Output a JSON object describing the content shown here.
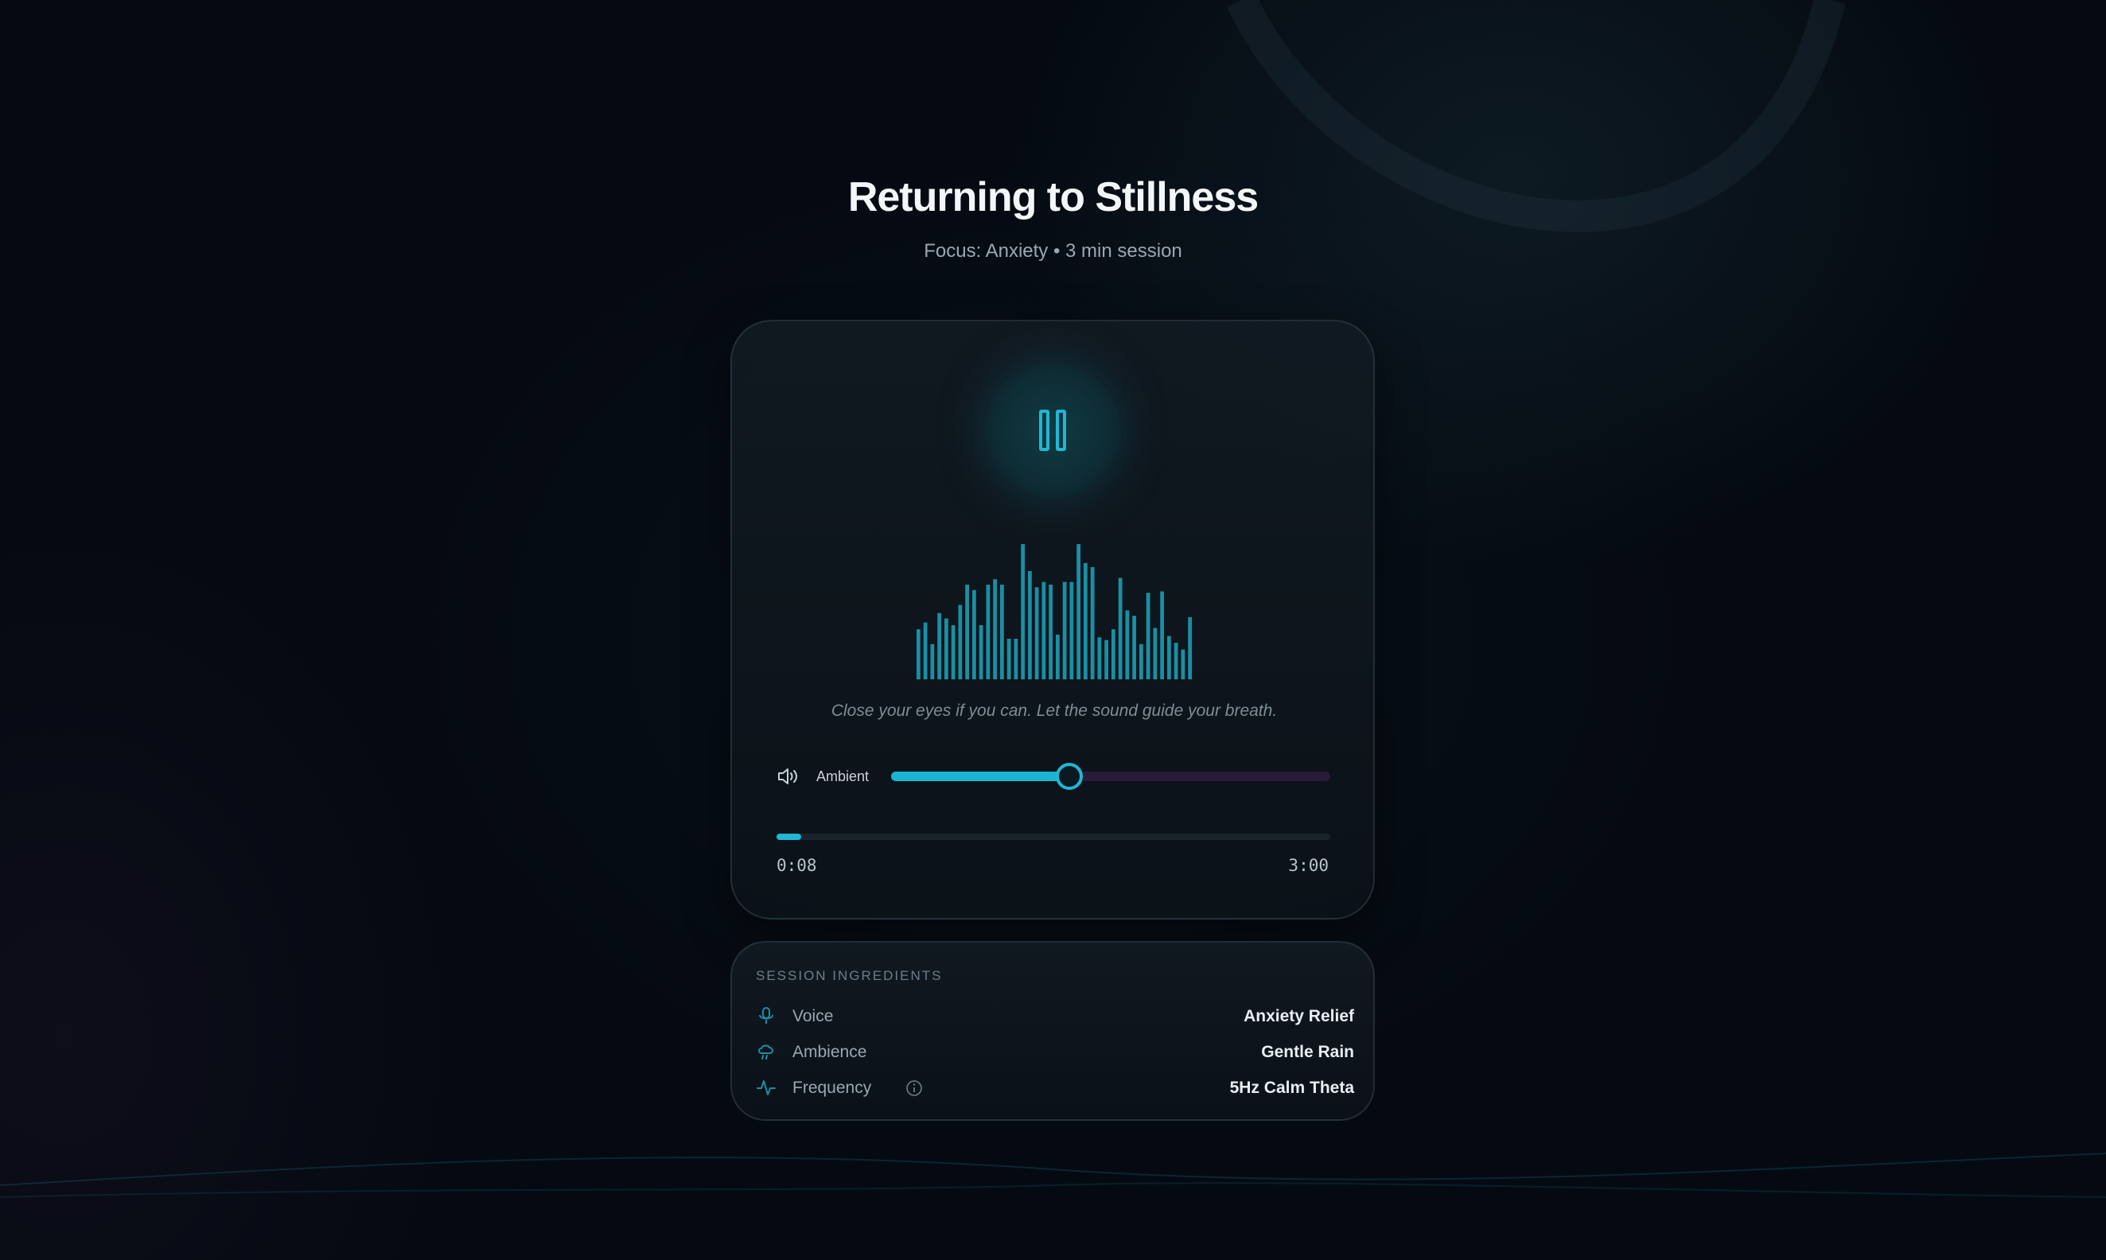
{
  "header": {
    "title": "Returning to Stillness",
    "subtitle": "Focus: Anxiety • 3 min session"
  },
  "player": {
    "play_state": "playing",
    "caption": "Close your eyes if you can. Let the sound guide your breath.",
    "waveform_levels": [
      0.37,
      0.42,
      0.26,
      0.49,
      0.45,
      0.4,
      0.55,
      0.7,
      0.66,
      0.4,
      0.7,
      0.74,
      0.7,
      0.3,
      0.3,
      1.0,
      0.8,
      0.68,
      0.72,
      0.7,
      0.33,
      0.72,
      0.72,
      1.0,
      0.86,
      0.83,
      0.31,
      0.29,
      0.37,
      0.75,
      0.51,
      0.47,
      0.26,
      0.64,
      0.38,
      0.65,
      0.32,
      0.27,
      0.22,
      0.46
    ],
    "ambient": {
      "label": "Ambient",
      "level": 0.405
    },
    "progress": {
      "current": "0:08",
      "total": "3:00",
      "fraction": 0.044
    },
    "colors": {
      "accent": "#1fb7d4",
      "wave": "#1a8fa3",
      "track_off": "#2a1a3a"
    }
  },
  "ingredients": {
    "heading": "SESSION INGREDIENTS",
    "rows": [
      {
        "label": "Voice",
        "value": "Anxiety Relief",
        "icon": "microphone-icon"
      },
      {
        "label": "Ambience",
        "value": "Gentle Rain",
        "icon": "rain-cloud-icon"
      },
      {
        "label": "Frequency",
        "value": "5Hz Calm Theta",
        "icon": "pulse-icon"
      }
    ]
  }
}
